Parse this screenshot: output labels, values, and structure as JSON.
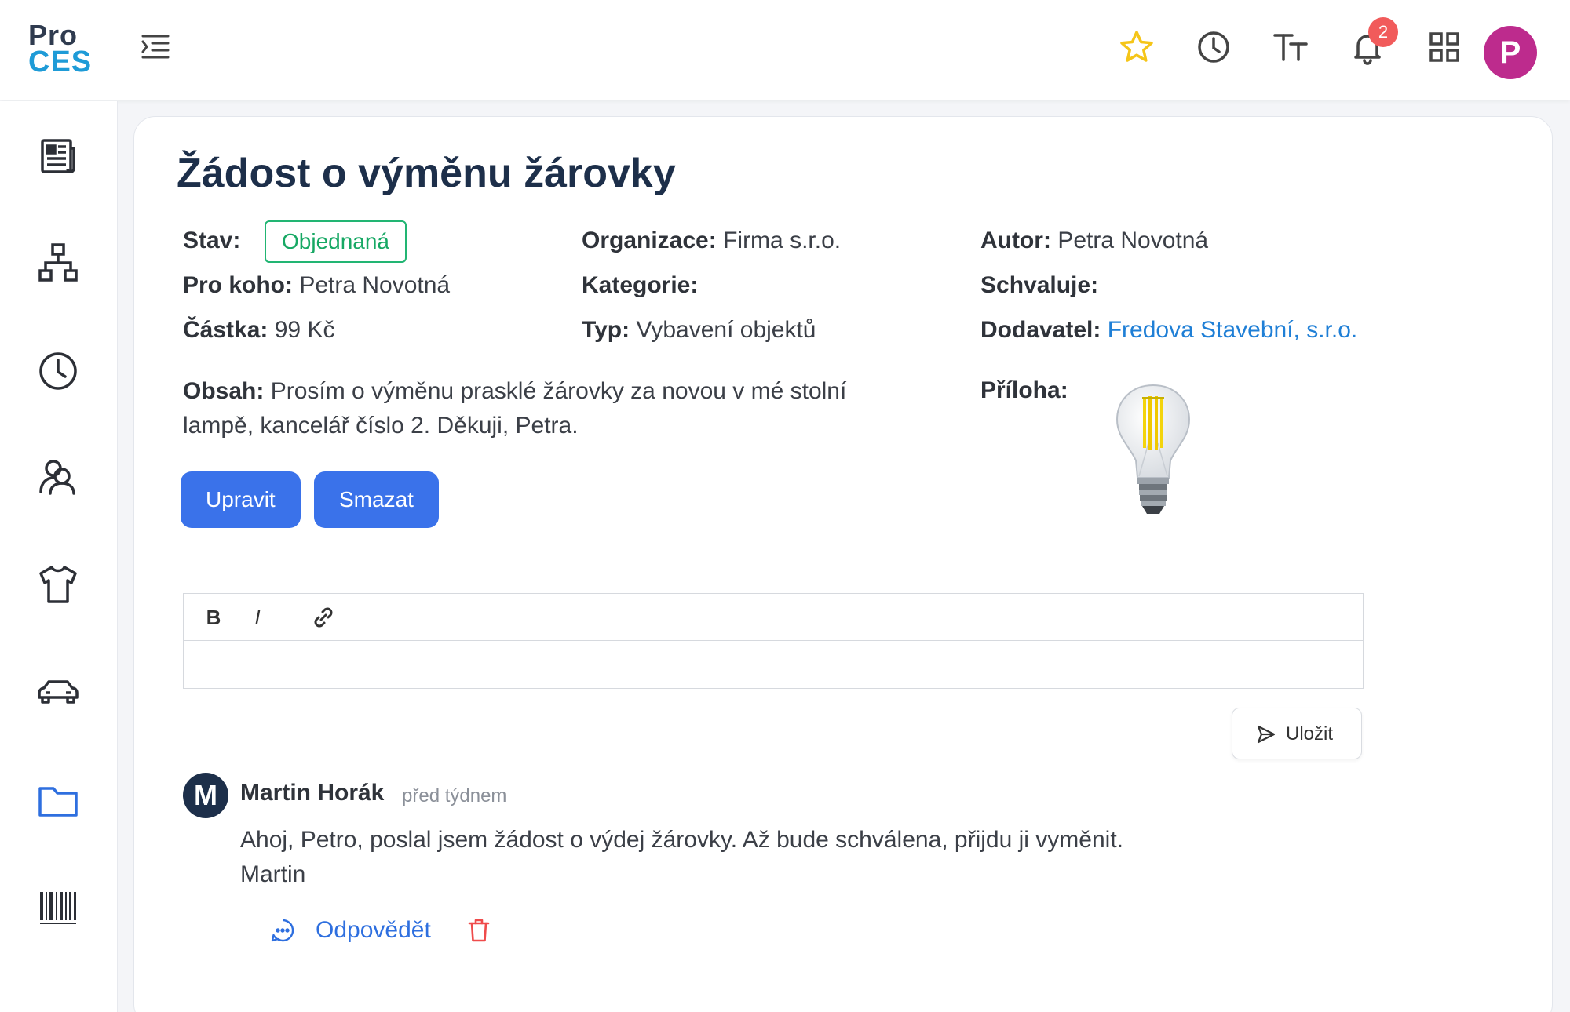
{
  "app": {
    "logo_top": "Pro",
    "logo_bottom": "CES",
    "user_initial": "P",
    "notification_count": "2",
    "colors": {
      "accent": "#3a72ea",
      "brand": "#1e9bd7",
      "status": "#22b573",
      "avatar": "#bd2b8d",
      "star": "#f5c518"
    }
  },
  "header_icons": [
    "star-icon",
    "clock-icon",
    "text-size-icon",
    "bell-icon",
    "grid-icon"
  ],
  "sidebar": {
    "items": [
      "newspaper-icon",
      "hierarchy-icon",
      "clock-icon",
      "users-icon",
      "shirt-icon",
      "car-icon",
      "folder-icon",
      "barcode-icon"
    ],
    "active": "folder-icon"
  },
  "request": {
    "title": "Žádost o výměnu žárovky",
    "status_label": "Stav:",
    "status_value": "Objednaná",
    "org_label": "Organizace:",
    "org_value": "Firma s.r.o.",
    "author_label": "Autor:",
    "author_value": "Petra Novotná",
    "for_label": "Pro koho:",
    "for_value": "Petra Novotná",
    "category_label": "Kategorie:",
    "category_value": "",
    "approver_label": "Schvaluje:",
    "approver_value": "",
    "amount_label": "Částka:",
    "amount_value": "99 Kč",
    "type_label": "Typ:",
    "type_value": "Vybavení objektů",
    "supplier_label": "Dodavatel:",
    "supplier_value": "Fredova Stavební, s.r.o.",
    "content_label": "Obsah:",
    "content_value": "Prosím o výměnu prasklé žárovky za novou v mé stolní lampě, kancelář číslo 2. Děkuji, Petra.",
    "attachment_label": "Příloha:",
    "edit_label": "Upravit",
    "delete_label": "Smazat"
  },
  "editor": {
    "bold": "B",
    "italic": "I",
    "save_label": "Uložit"
  },
  "comment": {
    "initial": "M",
    "author": "Martin Horák",
    "time": "před týdnem",
    "text_line1": "Ahoj, Petro, poslal jsem žádost o výdej žárovky. Až bude schválena, přijdu ji vyměnit.",
    "text_line2": "Martin",
    "reply_label": "Odpovědět"
  }
}
